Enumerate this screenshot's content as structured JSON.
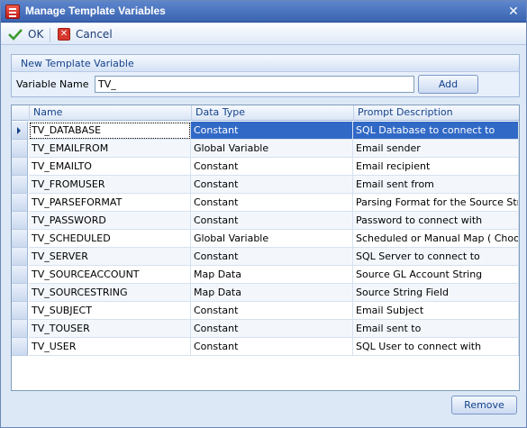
{
  "window": {
    "title": "Manage Template Variables",
    "close_glyph": "✕"
  },
  "toolbar": {
    "ok_label": "OK",
    "cancel_label": "Cancel"
  },
  "new_var": {
    "group_title": "New Template Variable",
    "label": "Variable Name",
    "value": "TV_",
    "add_label": "Add"
  },
  "grid": {
    "columns": [
      "Name",
      "Data Type",
      "Prompt Description"
    ],
    "rows": [
      {
        "name": "TV_DATABASE",
        "type": "Constant",
        "desc": "SQL Database to connect to"
      },
      {
        "name": "TV_EMAILFROM",
        "type": "Global Variable",
        "desc": "Email sender"
      },
      {
        "name": "TV_EMAILTO",
        "type": "Constant",
        "desc": "Email recipient"
      },
      {
        "name": "TV_FROMUSER",
        "type": "Constant",
        "desc": "Email sent from"
      },
      {
        "name": "TV_PARSEFORMAT",
        "type": "Constant",
        "desc": "Parsing Format for the Source Stri..."
      },
      {
        "name": "TV_PASSWORD",
        "type": "Constant",
        "desc": "Password to connect with"
      },
      {
        "name": "TV_SCHEDULED",
        "type": "Global Variable",
        "desc": "Scheduled or Manual Map ( Choos..."
      },
      {
        "name": "TV_SERVER",
        "type": "Constant",
        "desc": "SQL Server to connect to"
      },
      {
        "name": "TV_SOURCEACCOUNT",
        "type": "Map Data",
        "desc": "Source GL Account String"
      },
      {
        "name": "TV_SOURCESTRING",
        "type": "Map Data",
        "desc": "Source String Field"
      },
      {
        "name": "TV_SUBJECT",
        "type": "Constant",
        "desc": "Email Subject"
      },
      {
        "name": "TV_TOUSER",
        "type": "Constant",
        "desc": "Email sent to"
      },
      {
        "name": "TV_USER",
        "type": "Constant",
        "desc": "SQL User to connect with"
      }
    ],
    "remove_label": "Remove"
  }
}
